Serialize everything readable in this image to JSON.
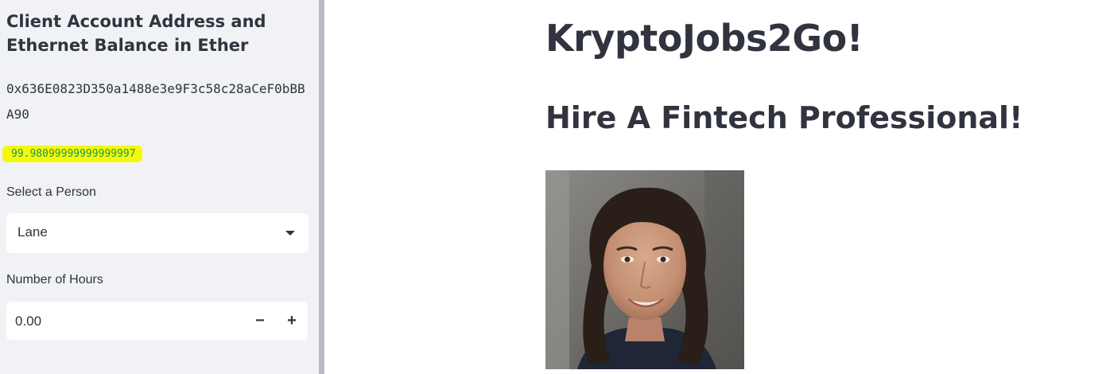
{
  "sidebar": {
    "header": "Client Account Address and Ethernet Balance in Ether",
    "address": "0x636E0823D350a1488e3e9F3c58c28aCeF0bBBA90",
    "balance": "99.98099999999999997",
    "select_label": "Select a Person",
    "select_value": "Lane",
    "hours_label": "Number of Hours",
    "hours_value": "0.00",
    "minus_label": "−",
    "plus_label": "+"
  },
  "main": {
    "title": "KryptoJobs2Go!",
    "subtitle": "Hire A Fintech Professional!"
  },
  "icons": {
    "dropdown": "chevron-down-icon",
    "minus": "minus-icon",
    "plus": "plus-icon"
  },
  "colors": {
    "sidebar_bg": "#f0f2f6",
    "text": "#31333f",
    "highlight": "#f4f90c",
    "balance_text": "#1a9a47"
  }
}
